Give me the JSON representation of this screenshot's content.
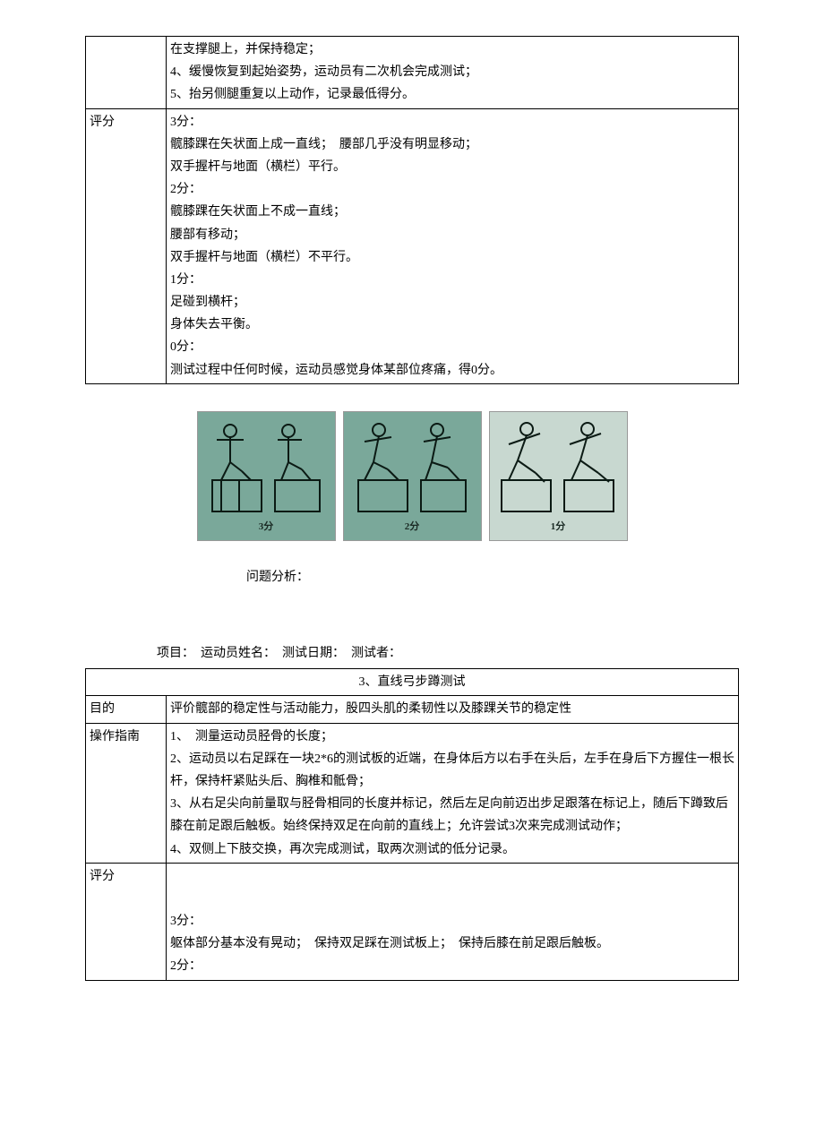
{
  "table1": {
    "row1": {
      "lines": [
        "在支撑腿上，并保持稳定；",
        "4、缓慢恢复到起始姿势，运动员有二次机会完成测试；",
        "5、抬另侧腿重复以上动作，记录最低得分。"
      ]
    },
    "row2": {
      "label": "评分",
      "lines": [
        "",
        "3分：",
        "髋膝踝在矢状面上成一直线；　腰部几乎没有明显移动；",
        "双手握杆与地面（横栏）平行。",
        "2分：",
        "髋膝踝在矢状面上不成一直线；",
        "腰部有移动；",
        "双手握杆与地面（横栏）不平行。",
        "1分：",
        "足碰到横杆；",
        "身体失去平衡。",
        "0分：",
        "测试过程中任何时候，运动员感觉身体某部位疼痛，得0分。"
      ]
    }
  },
  "figures": {
    "c1": "3分",
    "c2": "2分",
    "c3": "1分"
  },
  "analysis_label": "问题分析：",
  "header_line": "项目：　运动员姓名：　测试日期：　测试者：",
  "table2": {
    "title": "3、直线弓步蹲测试",
    "row1": {
      "label": "目的",
      "text": "评价髋部的稳定性与活动能力，股四头肌的柔韧性以及膝踝关节的稳定性"
    },
    "row2": {
      "label": "操作指南",
      "lines": [
        "1、　测量运动员胫骨的长度；",
        "2、运动员以右足踩在一块2*6的测试板的近端，在身体后方以右手在头后，左手在身后下方握住一根长杆，保持杆紧贴头后、胸椎和骶骨；",
        "3、从右足尖向前量取与胫骨相同的长度并标记，然后左足向前迈出步足跟落在标记上，随后下蹲致后膝在前足跟后触板。始终保持双足在向前的直线上；允许尝试3次来完成测试动作；",
        "4、双侧上下肢交换，再次完成测试，取两次测试的低分记录。"
      ]
    },
    "row3": {
      "label": "评分",
      "lines": [
        "",
        "",
        "3分：",
        "躯体部分基本没有晃动；　保持双足踩在测试板上；　保持后膝在前足跟后触板。",
        "2分："
      ]
    }
  }
}
